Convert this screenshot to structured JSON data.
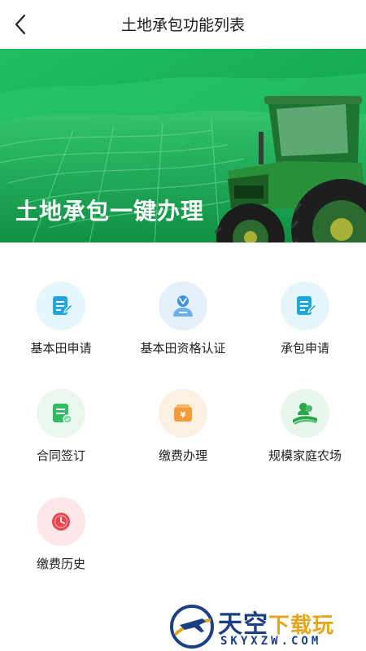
{
  "header": {
    "title": "土地承包功能列表"
  },
  "banner": {
    "text": "土地承包一键办理"
  },
  "items": [
    {
      "label": "基本田申请",
      "icon": "edit-document-icon",
      "bg": "#e4f5fb",
      "color": "#1fa6df"
    },
    {
      "label": "基本田资格认证",
      "icon": "user-verify-icon",
      "bg": "#e5f0fb",
      "color": "#3f90e6"
    },
    {
      "label": "承包申请",
      "icon": "edit-document-icon",
      "bg": "#e4f5fb",
      "color": "#1fa6df"
    },
    {
      "label": "合同签订",
      "icon": "contract-icon",
      "bg": "#e9f7ec",
      "color": "#2fbc62"
    },
    {
      "label": "缴费办理",
      "icon": "payment-icon",
      "bg": "#fdf0e2",
      "color": "#f39b36"
    },
    {
      "label": "规模家庭农场",
      "icon": "farm-icon",
      "bg": "#e8f6ec",
      "color": "#2aa74b"
    },
    {
      "label": "缴费历史",
      "icon": "clock-history-icon",
      "bg": "#fde7e8",
      "color": "#e9474f"
    }
  ],
  "watermark": {
    "title_a": "天空",
    "title_b": "下载玩",
    "site": "SKYXZW.COM"
  }
}
